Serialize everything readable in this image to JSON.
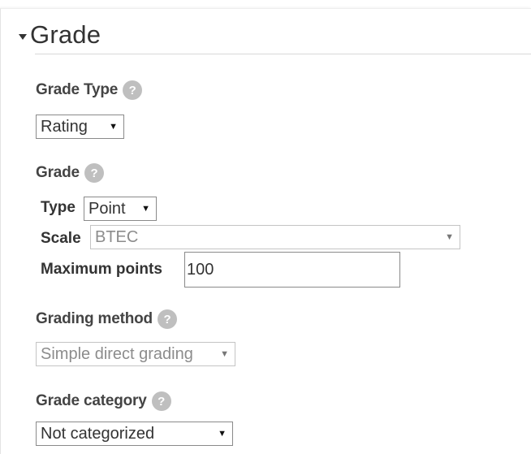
{
  "section": {
    "title": "Grade"
  },
  "grade_type": {
    "label": "Grade Type",
    "help": "?",
    "value": "Rating"
  },
  "grade": {
    "label": "Grade",
    "help": "?",
    "type_label": "Type",
    "type_value": "Point",
    "scale_label": "Scale",
    "scale_value": "BTEC",
    "max_points_label": "Maximum points",
    "max_points_value": "100"
  },
  "grading_method": {
    "label": "Grading method",
    "help": "?",
    "value": "Simple direct grading"
  },
  "grade_category": {
    "label": "Grade category",
    "help": "?",
    "value": "Not categorized"
  },
  "arrow_glyph": "▼"
}
